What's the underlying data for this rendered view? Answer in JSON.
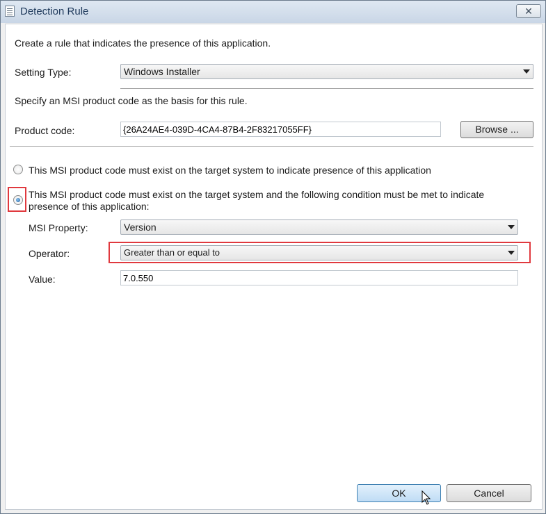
{
  "window": {
    "title": "Detection Rule",
    "close_symbol": "✕"
  },
  "intro_text": "Create a rule that indicates the presence of this application.",
  "setting_type": {
    "label": "Setting Type:",
    "value": "Windows Installer"
  },
  "msi_section_text": "Specify an MSI product code as the basis for this rule.",
  "product_code": {
    "label": "Product code:",
    "value": "{26A24AE4-039D-4CA4-87B4-2F83217055FF}",
    "browse_label": "Browse ..."
  },
  "radio_options": [
    {
      "label": "This MSI product code must exist on the target system to indicate presence of this application",
      "selected": false
    },
    {
      "label_line1": "This MSI product code must exist on the target system and the following condition must be met to indicate",
      "label_line2": "presence of this application:",
      "selected": true
    }
  ],
  "condition": {
    "msi_property": {
      "label": "MSI Property:",
      "value": "Version"
    },
    "operator": {
      "label": "Operator:",
      "value": "Greater than or equal to"
    },
    "value": {
      "label": "Value:",
      "value": "7.0.550"
    }
  },
  "buttons": {
    "ok": "OK",
    "cancel": "Cancel"
  },
  "colors": {
    "highlight": "#e0393e",
    "title_text": "#1e395b"
  }
}
